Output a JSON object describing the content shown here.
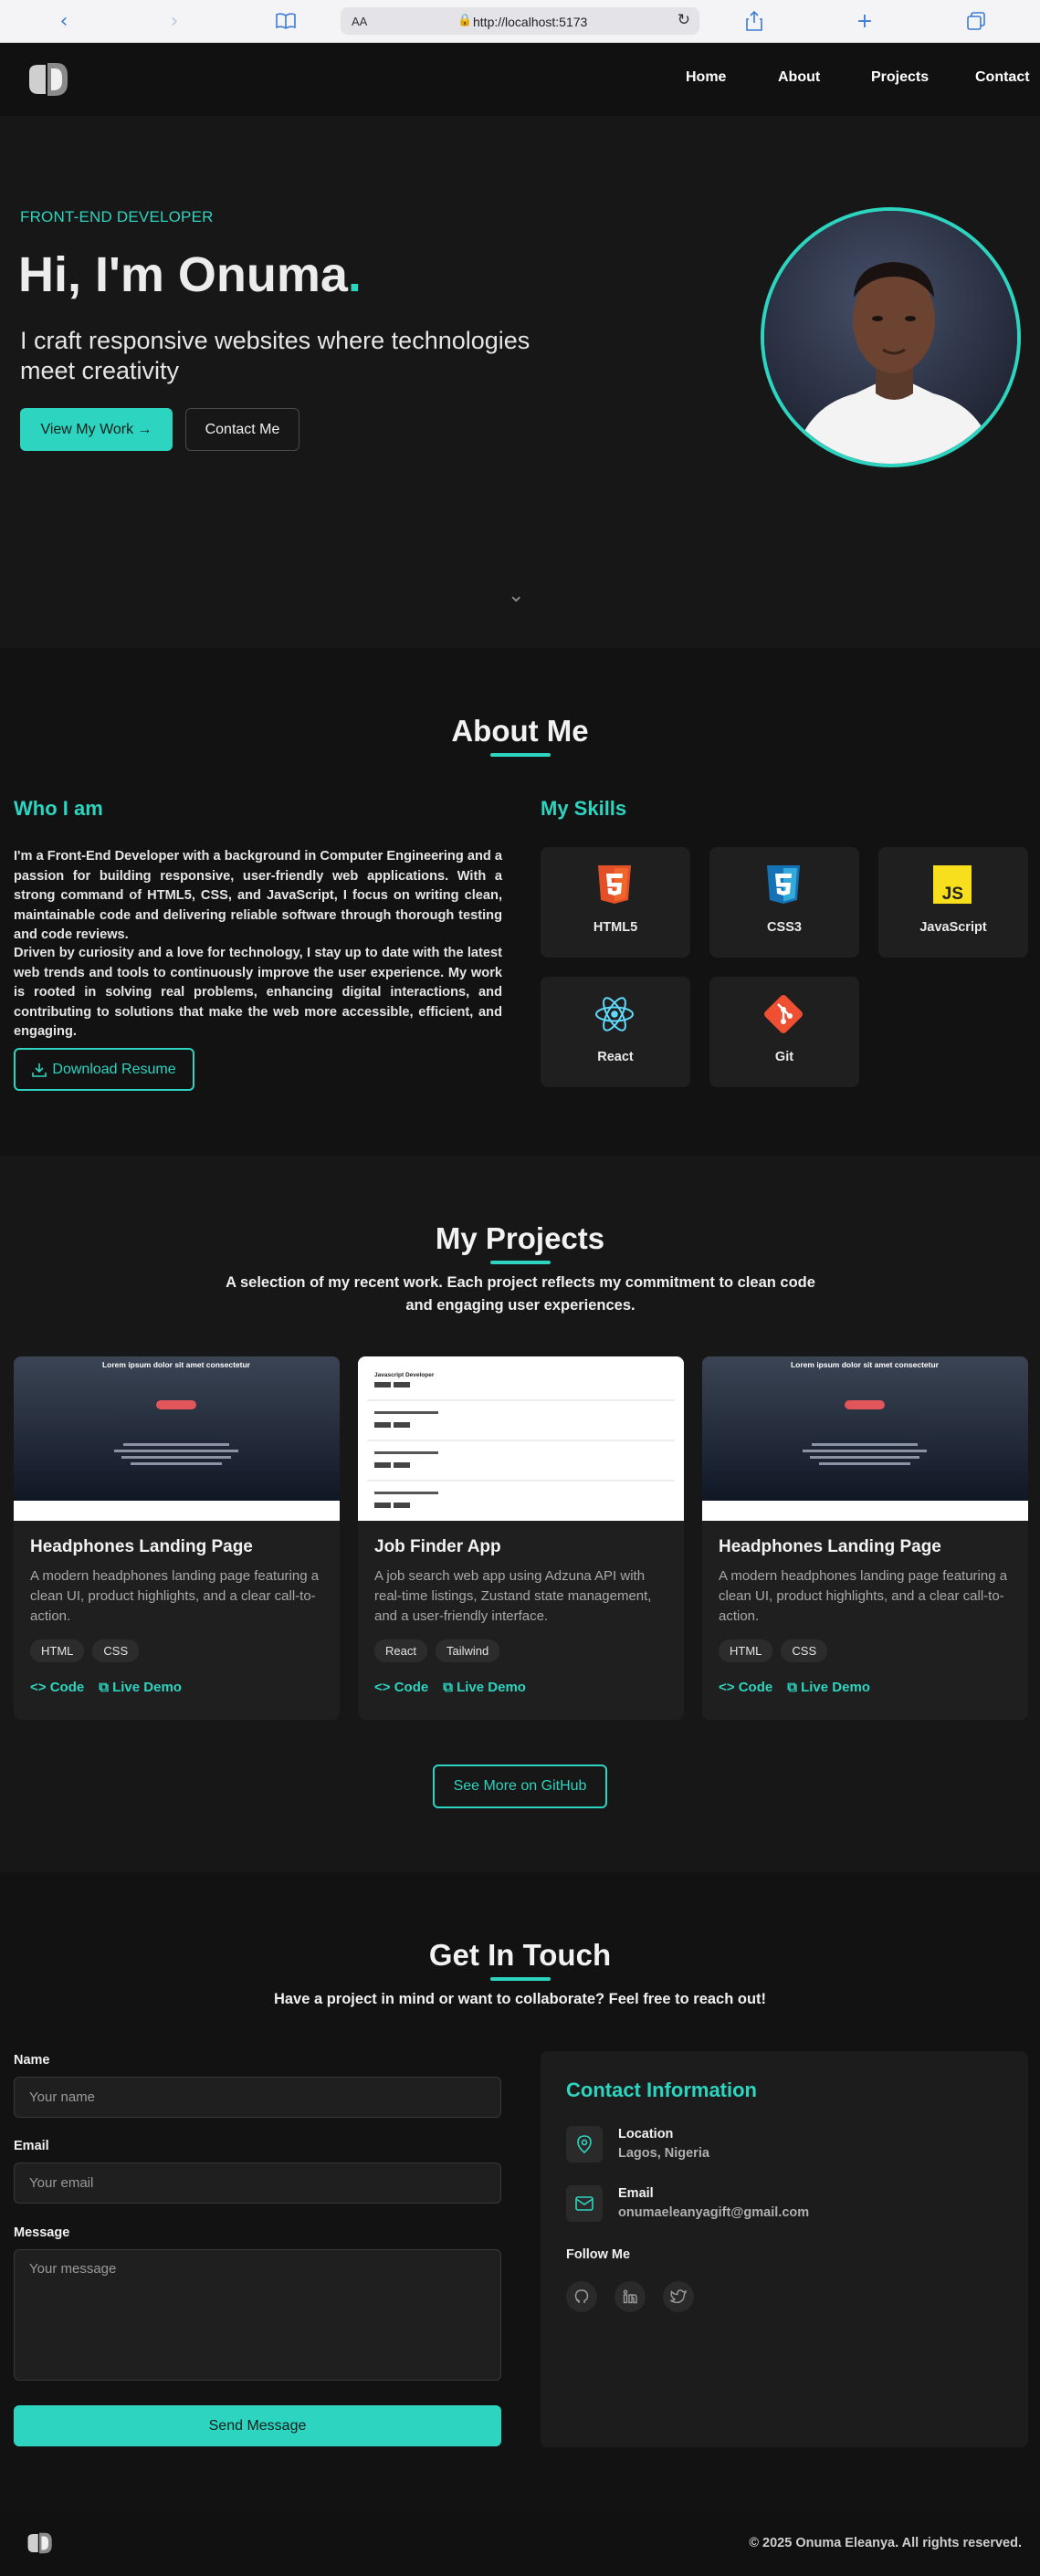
{
  "browser": {
    "aa_label": "AA",
    "url": "http://localhost:5173",
    "back_icon": "chevron-left-icon",
    "forward_icon": "chevron-right-icon",
    "bookmarks_icon": "book-icon",
    "share_icon": "share-icon",
    "new_tab_icon": "plus-icon",
    "tabs_icon": "tabs-icon"
  },
  "nav": {
    "links": [
      "Home",
      "About",
      "Projects",
      "Contact"
    ]
  },
  "hero": {
    "eyebrow": "FRONT-END DEVELOPER",
    "title": "Hi, I'm Onuma",
    "title_dot": ".",
    "subtitle": "I craft responsive websites where technologies meet creativity",
    "primary_button": "View My Work →",
    "secondary_button": "Contact Me",
    "accent_color": "#2dd4bf"
  },
  "about": {
    "title": "About Me",
    "who_heading": "Who I am",
    "paragraph1": "I'm a Front-End Developer with a background in Computer Engineering and a passion for building responsive, user-friendly web applications. With a strong command of HTML5, CSS, and JavaScript, I focus on writing clean, maintainable code and delivering reliable software through thorough testing and code reviews.",
    "paragraph2": "Driven by curiosity and a love for technology, I stay up to date with the latest web trends and tools to continuously improve the user experience. My work is rooted in solving real problems, enhancing digital interactions, and contributing to solutions that make the web more accessible, efficient, and engaging.",
    "resume_button": "Download Resume",
    "skills_heading": "My Skills",
    "skills": [
      {
        "name": "HTML5",
        "icon": "html5-icon"
      },
      {
        "name": "CSS3",
        "icon": "css3-icon"
      },
      {
        "name": "JavaScript",
        "icon": "javascript-icon"
      },
      {
        "name": "React",
        "icon": "react-icon"
      },
      {
        "name": "Git",
        "icon": "git-icon"
      }
    ]
  },
  "projects": {
    "title": "My Projects",
    "subtitle": "A selection of my recent work. Each project reflects my commitment to clean code and engaging user experiences.",
    "items": [
      {
        "title": "Headphones Landing Page",
        "description": "A modern headphones landing page featuring a clean UI, product highlights, and a clear call-to-action.",
        "tags": [
          "HTML",
          "CSS"
        ],
        "code_label": "Code",
        "demo_label": "Live Demo",
        "thumb_heading": "Lorem ipsum dolor sit amet consectetur"
      },
      {
        "title": "Job Finder App",
        "description": "A job search web app using Adzuna API with real-time listings, Zustand state management, and a user-friendly interface.",
        "tags": [
          "React",
          "Tailwind"
        ],
        "code_label": "Code",
        "demo_label": "Live Demo",
        "thumb_heading": "Javascript Developer"
      },
      {
        "title": "Headphones Landing Page",
        "description": "A modern headphones landing page featuring a clean UI, product highlights, and a clear call-to-action.",
        "tags": [
          "HTML",
          "CSS"
        ],
        "code_label": "Code",
        "demo_label": "Live Demo",
        "thumb_heading": "Lorem ipsum dolor sit amet consectetur"
      }
    ],
    "github_button": "See More on GitHub"
  },
  "contact": {
    "title": "Get In Touch",
    "subtitle": "Have a project in mind or want to collaborate? Feel free to reach out!",
    "name_label": "Name",
    "name_placeholder": "Your name",
    "email_label": "Email",
    "email_placeholder": "Your email",
    "message_label": "Message",
    "message_placeholder": "Your message",
    "send_button": "Send Message",
    "info_title": "Contact Information",
    "location_label": "Location",
    "location_value": "Lagos, Nigeria",
    "email_info_label": "Email",
    "email_info_value": "onumaeleanyagift@gmail.com",
    "follow_label": "Follow Me",
    "socials": [
      "github-icon",
      "linkedin-icon",
      "twitter-icon"
    ]
  },
  "footer": {
    "copyright": "© 2025 Onuma Eleanya. All rights reserved."
  }
}
